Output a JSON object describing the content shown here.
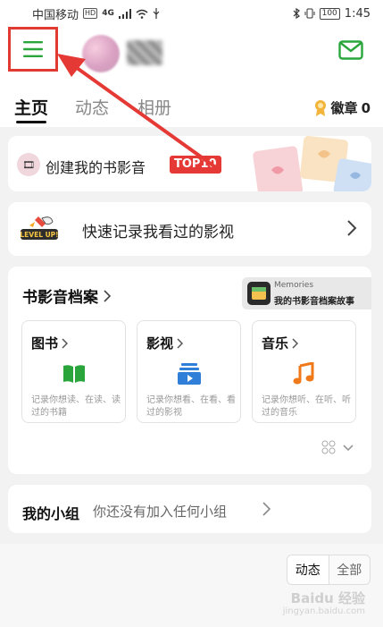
{
  "status_bar": {
    "carrier": "中国移动",
    "network_badge": "HD",
    "network_type": "4G",
    "battery": "100",
    "time": "1:45"
  },
  "header": {
    "menu_icon": "hamburger-menu-icon",
    "mail_icon": "mail-icon",
    "accent_color": "#2aa53b",
    "highlight_color": "#e03a32"
  },
  "tabs": [
    {
      "label": "主页",
      "active": true
    },
    {
      "label": "动态",
      "active": false
    },
    {
      "label": "相册",
      "active": false
    }
  ],
  "badges": {
    "label": "徽章",
    "count": "0"
  },
  "create_card": {
    "label": "创建我的书影音",
    "tag": "TOP10"
  },
  "record_card": {
    "label": "快速记录我看过的影视",
    "icon_text": "LEVEL UP!"
  },
  "archive": {
    "title": "书影音档案",
    "memories": {
      "small": "Memories",
      "big": "我的书影音档案故事"
    },
    "items": [
      {
        "title": "图书",
        "desc": "记录你想读、在读、读过的书籍",
        "icon": "book-icon",
        "color": "#2aa53b"
      },
      {
        "title": "影视",
        "desc": "记录你想看、在看、看过的影视",
        "icon": "video-icon",
        "color": "#2f7ed8"
      },
      {
        "title": "音乐",
        "desc": "记录你想听、在听、听过的音乐",
        "icon": "music-note-icon",
        "color": "#f07a1a"
      }
    ]
  },
  "group": {
    "title": "我的小组",
    "text": "你还没有加入任何小组"
  },
  "feed_filter": {
    "options": [
      "动态",
      "全部"
    ],
    "selected": "动态"
  },
  "watermark": {
    "text": "Baidu 经验",
    "url": "jingyan.baidu.com"
  }
}
